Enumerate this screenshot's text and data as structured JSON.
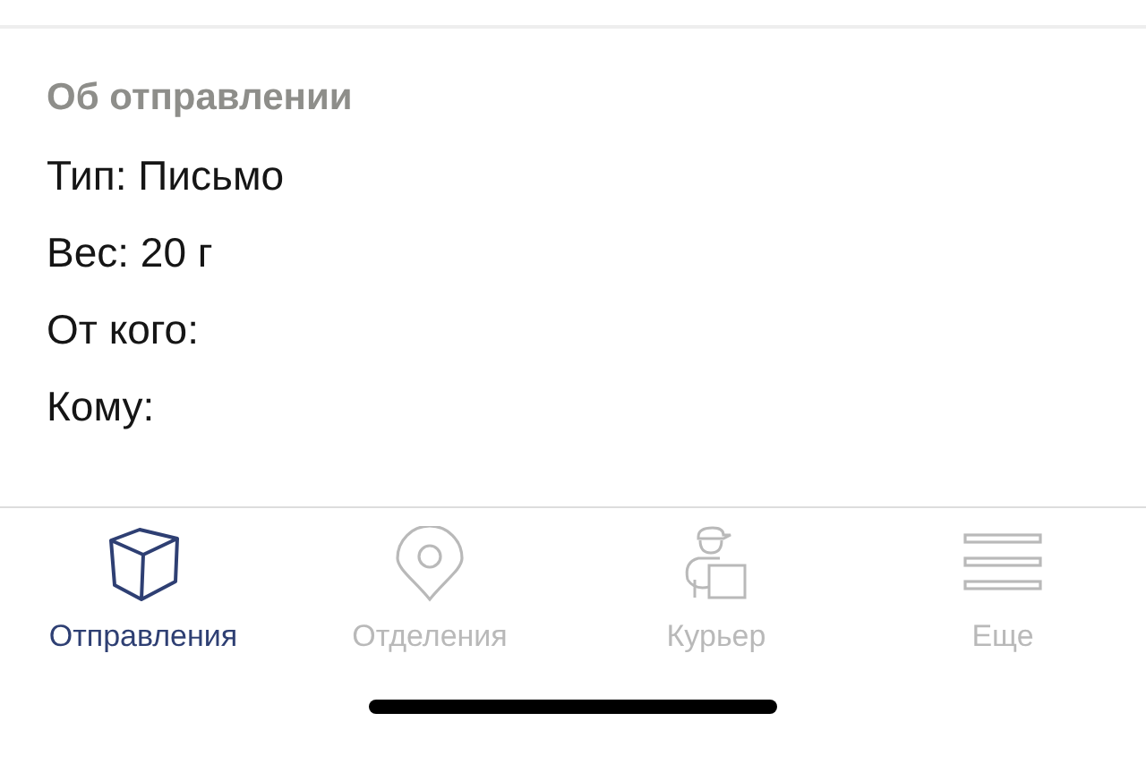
{
  "section": {
    "title": "Об отправлении",
    "lines": [
      {
        "text": "Тип: Письмо"
      },
      {
        "text": "Вес: 20 г"
      },
      {
        "text": "От кого:"
      },
      {
        "text": "Кому:"
      }
    ]
  },
  "tab_bar": [
    {
      "label": "Отправления",
      "kind": "box",
      "selected": true
    },
    {
      "label": "Отделения",
      "kind": "pin",
      "selected": false
    },
    {
      "label": "Курьер",
      "kind": "courier",
      "selected": false
    },
    {
      "label": "Еще",
      "kind": "menu",
      "selected": false
    }
  ]
}
